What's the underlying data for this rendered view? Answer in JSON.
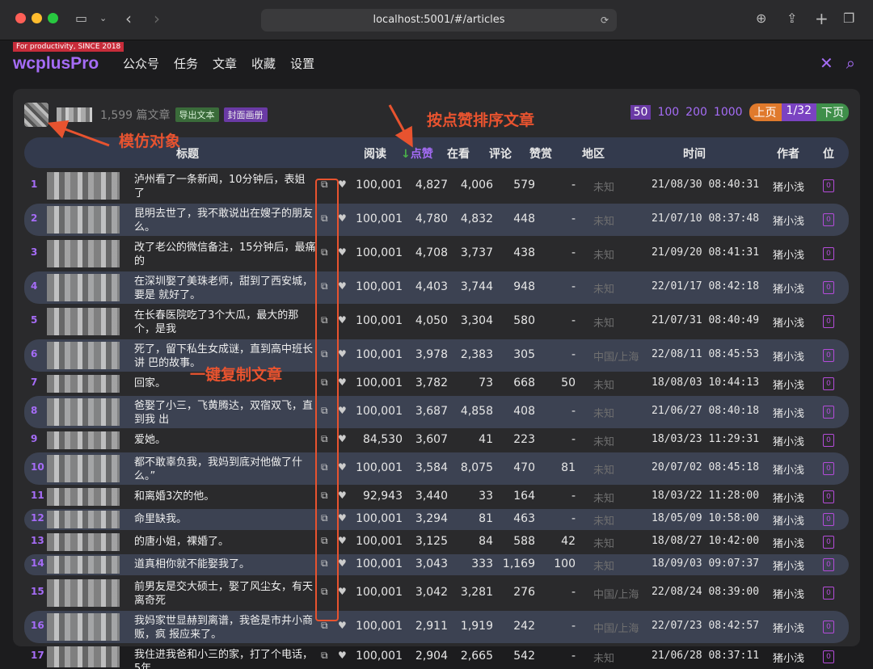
{
  "browser": {
    "url": "localhost:5001/#/articles"
  },
  "app": {
    "tagline": "For productivity, SINCE 2018",
    "logo": "wcplusPro",
    "nav": [
      "公众号",
      "任务",
      "文章",
      "收藏",
      "设置"
    ]
  },
  "summary": {
    "count": "1,599 篇文章",
    "export_label": "导出文本",
    "cover_label": "封面画册"
  },
  "pager": {
    "sizes": [
      "50",
      "100",
      "200",
      "1000"
    ],
    "active_size": "50",
    "prev": "上页",
    "current": "1/32",
    "next": "下页"
  },
  "columns": {
    "title": "标题",
    "read": "阅读",
    "like_arrow": "↓",
    "like": "点赞",
    "look": "在看",
    "comment": "评论",
    "reward": "赞赏",
    "area": "地区",
    "time": "时间",
    "author": "作者",
    "pos": "位"
  },
  "rows": [
    {
      "idx": "1",
      "title": "泸州看了一条新闻，10分钟后，表姐\n了",
      "read": "100,001",
      "like": "4,827",
      "look": "4,006",
      "comment": "579",
      "reward": "-",
      "area": "未知",
      "time": "21/08/30 08:40:31",
      "author": "猪小浅",
      "pos": "0"
    },
    {
      "idx": "2",
      "title": "昆明去世了，我不敢说出在嫂子的朋友\n么。",
      "read": "100,001",
      "like": "4,780",
      "look": "4,832",
      "comment": "448",
      "reward": "-",
      "area": "未知",
      "time": "21/07/10 08:37:48",
      "author": "猪小浅",
      "pos": "0"
    },
    {
      "idx": "3",
      "title": "改了老公的微信备注，15分钟后，最痛的",
      "read": "100,001",
      "like": "4,708",
      "look": "3,737",
      "comment": "438",
      "reward": "-",
      "area": "未知",
      "time": "21/09/20 08:41:31",
      "author": "猪小浅",
      "pos": "0"
    },
    {
      "idx": "4",
      "title": "在深圳娶了美珠老师，甜到了西安城，要是\n就好了。",
      "read": "100,001",
      "like": "4,403",
      "look": "3,744",
      "comment": "948",
      "reward": "-",
      "area": "未知",
      "time": "22/01/17 08:42:18",
      "author": "猪小浅",
      "pos": "0"
    },
    {
      "idx": "5",
      "title": "在长春医院吃了3个大瓜，最大的那个，是我",
      "read": "100,001",
      "like": "4,050",
      "look": "3,304",
      "comment": "580",
      "reward": "-",
      "area": "未知",
      "time": "21/07/31 08:40:49",
      "author": "猪小浅",
      "pos": "0"
    },
    {
      "idx": "6",
      "title": "死了，留下私生女成谜，直到高中班长讲\n巴的故事。",
      "read": "100,001",
      "like": "3,978",
      "look": "2,383",
      "comment": "305",
      "reward": "-",
      "area": "中国/上海",
      "time": "22/08/11 08:45:53",
      "author": "猪小浅",
      "pos": "0"
    },
    {
      "idx": "7",
      "title": "回家。",
      "read": "100,001",
      "like": "3,782",
      "look": "73",
      "comment": "668",
      "reward": "50",
      "area": "未知",
      "time": "18/08/03 10:44:13",
      "author": "猪小浅",
      "pos": "0"
    },
    {
      "idx": "8",
      "title": "爸娶了小三，飞黄腾达，双宿双飞，直到我\n出",
      "read": "100,001",
      "like": "3,687",
      "look": "4,858",
      "comment": "408",
      "reward": "-",
      "area": "未知",
      "time": "21/06/27 08:40:18",
      "author": "猪小浅",
      "pos": "0"
    },
    {
      "idx": "9",
      "title": "爱她。",
      "read": "84,530",
      "like": "3,607",
      "look": "41",
      "comment": "223",
      "reward": "-",
      "area": "未知",
      "time": "18/03/23 11:29:31",
      "author": "猪小浅",
      "pos": "0"
    },
    {
      "idx": "10",
      "title": "都不敢辜负我，我妈到底对他做了什么。”",
      "read": "100,001",
      "like": "3,584",
      "look": "8,075",
      "comment": "470",
      "reward": "81",
      "area": "未知",
      "time": "20/07/02 08:45:18",
      "author": "猪小浅",
      "pos": "0"
    },
    {
      "idx": "11",
      "title": "和离婚3次的他。",
      "read": "92,943",
      "like": "3,440",
      "look": "33",
      "comment": "164",
      "reward": "-",
      "area": "未知",
      "time": "18/03/22 11:28:00",
      "author": "猪小浅",
      "pos": "0"
    },
    {
      "idx": "12",
      "title": "命里缺我。",
      "read": "100,001",
      "like": "3,294",
      "look": "81",
      "comment": "463",
      "reward": "-",
      "area": "未知",
      "time": "18/05/09 10:58:00",
      "author": "猪小浅",
      "pos": "0"
    },
    {
      "idx": "13",
      "title": "的唐小姐，裸婚了。",
      "read": "100,001",
      "like": "3,125",
      "look": "84",
      "comment": "588",
      "reward": "42",
      "area": "未知",
      "time": "18/08/27 10:42:00",
      "author": "猪小浅",
      "pos": "0"
    },
    {
      "idx": "14",
      "title": "道真相你就不能娶我了。",
      "read": "100,001",
      "like": "3,043",
      "look": "333",
      "comment": "1,169",
      "reward": "100",
      "area": "未知",
      "time": "18/09/03 09:07:37",
      "author": "猪小浅",
      "pos": "0"
    },
    {
      "idx": "15",
      "title": "前男友是交大硕士，娶了风尘女，有天离奇死",
      "read": "100,001",
      "like": "3,042",
      "look": "3,281",
      "comment": "276",
      "reward": "-",
      "area": "中国/上海",
      "time": "22/08/24 08:39:00",
      "author": "猪小浅",
      "pos": "0"
    },
    {
      "idx": "16",
      "title": "我妈家世显赫到离谱，我爸是市井小商贩，疯\n报应来了。",
      "read": "100,001",
      "like": "2,911",
      "look": "1,919",
      "comment": "242",
      "reward": "-",
      "area": "中国/上海",
      "time": "22/07/23 08:42:57",
      "author": "猪小浅",
      "pos": "0"
    },
    {
      "idx": "17",
      "title": "我住进我爸和小三的家，打了个电话，5年",
      "read": "100,001",
      "like": "2,904",
      "look": "2,665",
      "comment": "542",
      "reward": "-",
      "area": "未知",
      "time": "21/06/28 08:37:11",
      "author": "猪小浅",
      "pos": "0"
    }
  ],
  "annotations": {
    "imitate": "模仿对象",
    "sort_by_like": "按点赞排序文章",
    "copy_article": "一键复制文章"
  },
  "colors": {
    "accent": "#a56cf6",
    "annotation": "#e8532f",
    "row_alt": "#3c4252"
  }
}
